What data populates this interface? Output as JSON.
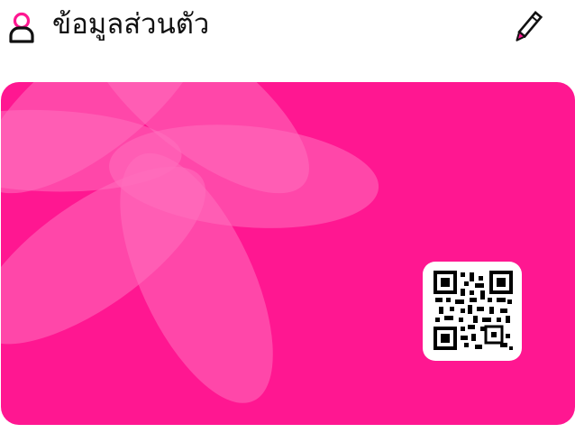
{
  "header": {
    "title": "ข้อมูลส่วนตัว",
    "user_icon": "user-outline-icon",
    "edit_icon": "pencil-icon"
  },
  "card": {
    "background_color": "#ff1791",
    "decoration": "flower-petals",
    "qr_icon": "qr-code-icon"
  },
  "colors": {
    "accent": "#ff1791",
    "petal": "#ff6fbd",
    "text": "#111111"
  }
}
